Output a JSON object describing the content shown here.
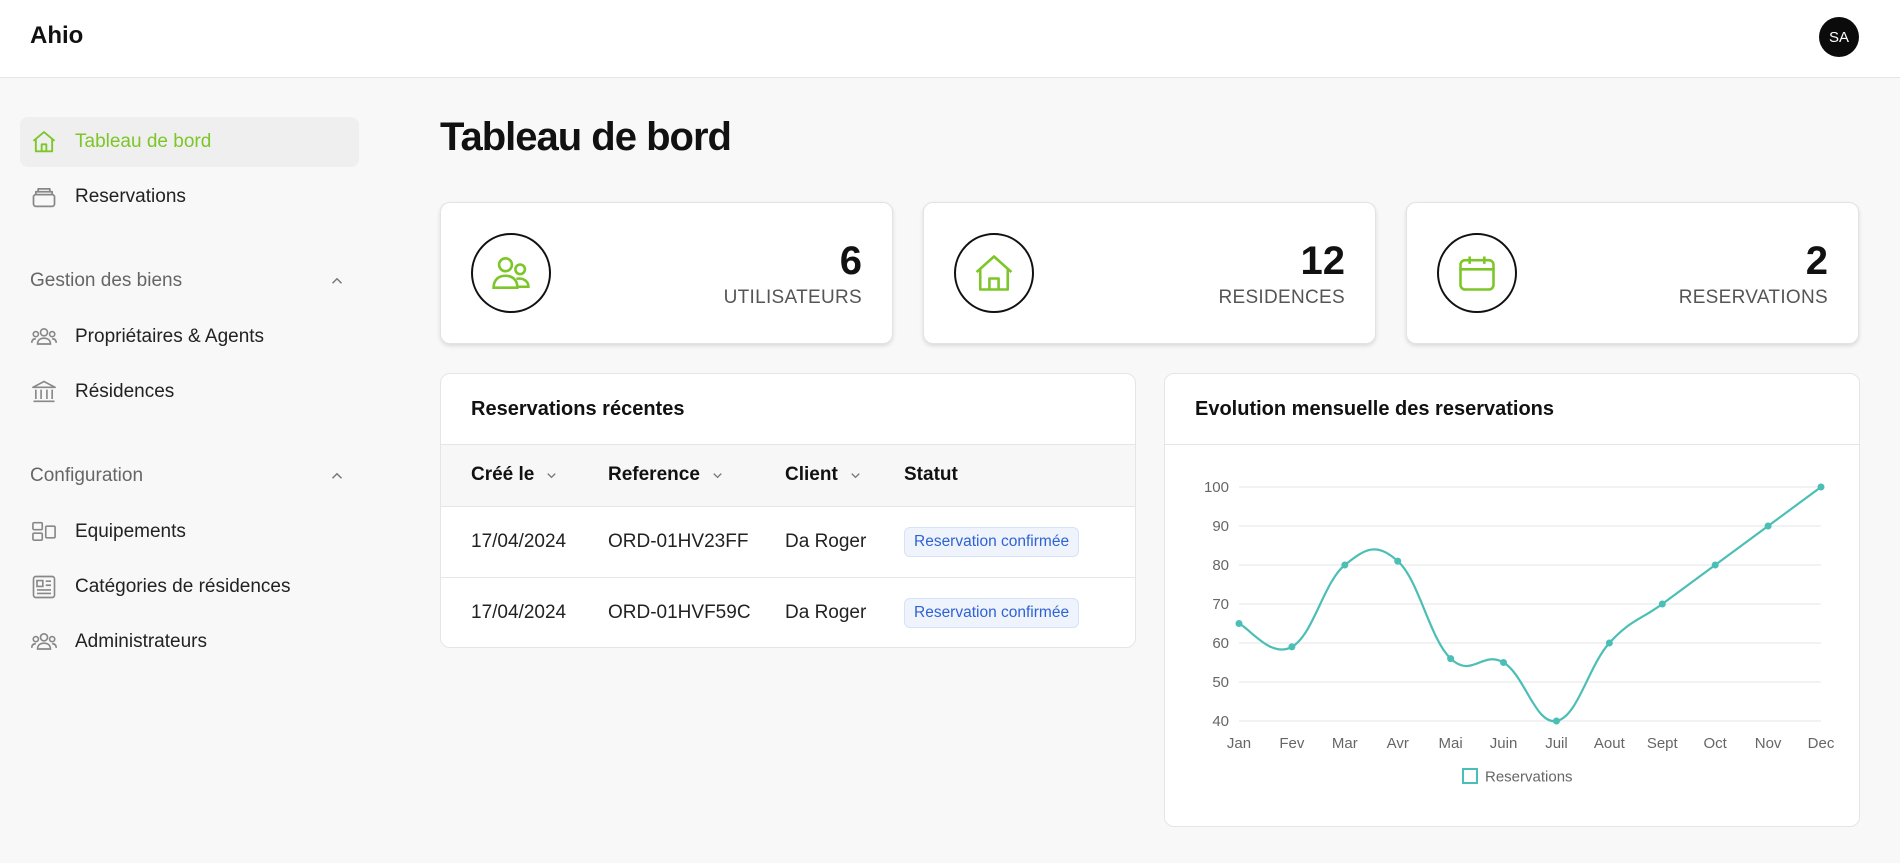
{
  "app": {
    "brand": "Ahio",
    "avatar_initials": "SA"
  },
  "sidebar": {
    "main_items": [
      {
        "label": "Tableau de bord",
        "icon": "home-icon",
        "active": true
      },
      {
        "label": "Reservations",
        "icon": "stack-icon",
        "active": false
      }
    ],
    "sections": [
      {
        "title": "Gestion des biens",
        "items": [
          {
            "label": "Propriétaires & Agents",
            "icon": "users-icon"
          },
          {
            "label": "Résidences",
            "icon": "bank-icon"
          }
        ]
      },
      {
        "title": "Configuration",
        "items": [
          {
            "label": "Equipements",
            "icon": "layout-icon"
          },
          {
            "label": "Catégories de résidences",
            "icon": "newspaper-icon"
          },
          {
            "label": "Administrateurs",
            "icon": "users-icon"
          }
        ]
      }
    ]
  },
  "page": {
    "title": "Tableau de bord"
  },
  "stats": [
    {
      "value": "6",
      "label": "UTILISATEURS",
      "icon": "users-icon"
    },
    {
      "value": "12",
      "label": "RESIDENCES",
      "icon": "home-icon"
    },
    {
      "value": "2",
      "label": "RESERVATIONS",
      "icon": "calendar-icon"
    }
  ],
  "recent": {
    "title": "Reservations récentes",
    "columns": [
      "Créé le",
      "Reference",
      "Client",
      "Statut"
    ],
    "rows": [
      {
        "date": "17/04/2024",
        "ref": "ORD-01HV23FF",
        "client": "Da Roger",
        "status": "Reservation confirmée"
      },
      {
        "date": "17/04/2024",
        "ref": "ORD-01HVF59C",
        "client": "Da Roger",
        "status": "Reservation confirmée"
      }
    ]
  },
  "colors": {
    "accent": "#7cc627",
    "chart_line": "#4bbfb5",
    "badge_text": "#2f63d4"
  },
  "chart_data": {
    "type": "line",
    "title": "Evolution mensuelle des reservations",
    "categories": [
      "Jan",
      "Fev",
      "Mar",
      "Avr",
      "Mai",
      "Juin",
      "Juil",
      "Aout",
      "Sept",
      "Oct",
      "Nov",
      "Dec"
    ],
    "series": [
      {
        "name": "Reservations",
        "values": [
          65,
          59,
          80,
          81,
          56,
          55,
          40,
          60,
          70,
          80,
          90,
          100
        ]
      }
    ],
    "ylim": [
      40,
      100
    ],
    "yticks": [
      40,
      50,
      60,
      70,
      80,
      90,
      100
    ],
    "grid": true,
    "legend": "bottom"
  }
}
